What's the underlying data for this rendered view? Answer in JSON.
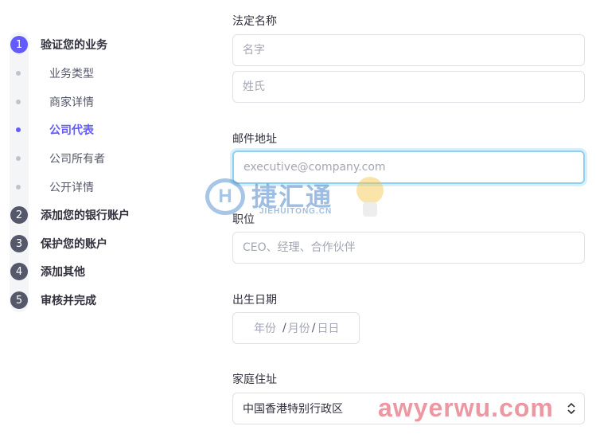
{
  "sidebar": {
    "steps": [
      {
        "number": "1",
        "label": "验证您的业务",
        "active": true
      },
      {
        "number": "2",
        "label": "添加您的银行账户"
      },
      {
        "number": "3",
        "label": "保护您的账户"
      },
      {
        "number": "4",
        "label": "添加其他"
      },
      {
        "number": "5",
        "label": "审核并完成"
      }
    ],
    "substeps": [
      {
        "label": "业务类型"
      },
      {
        "label": "商家详情"
      },
      {
        "label": "公司代表",
        "current": true
      },
      {
        "label": "公司所有者"
      },
      {
        "label": "公开详情"
      }
    ]
  },
  "form": {
    "legal_name": {
      "label": "法定名称",
      "first_name_placeholder": "名字",
      "last_name_placeholder": "姓氏"
    },
    "email": {
      "label": "邮件地址",
      "placeholder": "executive@company.com"
    },
    "title": {
      "label": "职位",
      "placeholder": "CEO、经理、合作伙伴"
    },
    "dob": {
      "label": "出生日期",
      "year_placeholder": "年份",
      "month_placeholder": "月份",
      "day_placeholder": "日日",
      "separator": "/"
    },
    "address": {
      "label": "家庭住址",
      "country_value": "中国香港特别行政区"
    }
  },
  "watermarks": {
    "logo_text": "捷汇通",
    "logo_sub": "JIEHUITONG.CN",
    "logo_letter": "H",
    "site_text": "awyerwu.com"
  },
  "colors": {
    "accent": "#635bff",
    "focus_ring": "#8fd0ee",
    "step_inactive": "#55586a"
  }
}
